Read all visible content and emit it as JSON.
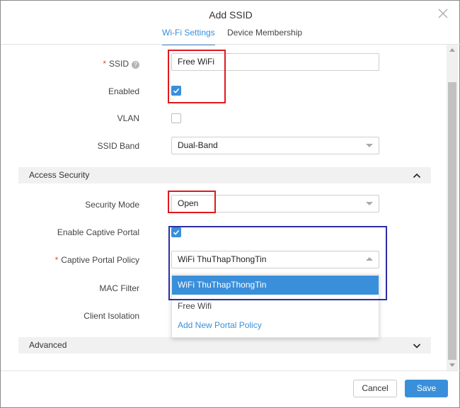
{
  "dialog": {
    "title": "Add SSID",
    "tabs": [
      {
        "label": "Wi-Fi Settings",
        "active": true
      },
      {
        "label": "Device Membership",
        "active": false
      }
    ]
  },
  "form": {
    "ssid": {
      "label": "SSID",
      "required": "*",
      "help_icon": "?",
      "value": "Free WiFi"
    },
    "enabled": {
      "label": "Enabled",
      "checked": true
    },
    "vlan": {
      "label": "VLAN",
      "checked": false
    },
    "ssid_band": {
      "label": "SSID Band",
      "value": "Dual-Band"
    }
  },
  "access_security": {
    "title": "Access Security",
    "security_mode": {
      "label": "Security Mode",
      "value": "Open"
    },
    "enable_captive_portal": {
      "label": "Enable Captive Portal",
      "checked": true
    },
    "captive_portal_policy": {
      "label": "Captive Portal Policy",
      "required": "*",
      "value": "WiFi ThuThapThongTin",
      "options": [
        {
          "label": "WiFi ThuThapThongTin",
          "selected": true
        },
        {
          "label": "Free Wifi",
          "selected": false
        },
        {
          "label": "Add New Portal Policy",
          "link": true
        }
      ]
    },
    "mac_filter": {
      "label": "MAC Filter"
    },
    "client_isolation": {
      "label": "Client Isolation"
    }
  },
  "advanced": {
    "title": "Advanced"
  },
  "footer": {
    "cancel_label": "Cancel",
    "save_label": "Save"
  },
  "colors": {
    "accent": "#3a8fdb",
    "highlight_red": "#e0191c",
    "highlight_blue": "#2a2fa6"
  },
  "icons": {
    "close": "close-icon",
    "help": "help-icon",
    "chevron_up": "chevron-up-icon",
    "chevron_down": "chevron-down-icon",
    "check": "checkmark-icon"
  }
}
